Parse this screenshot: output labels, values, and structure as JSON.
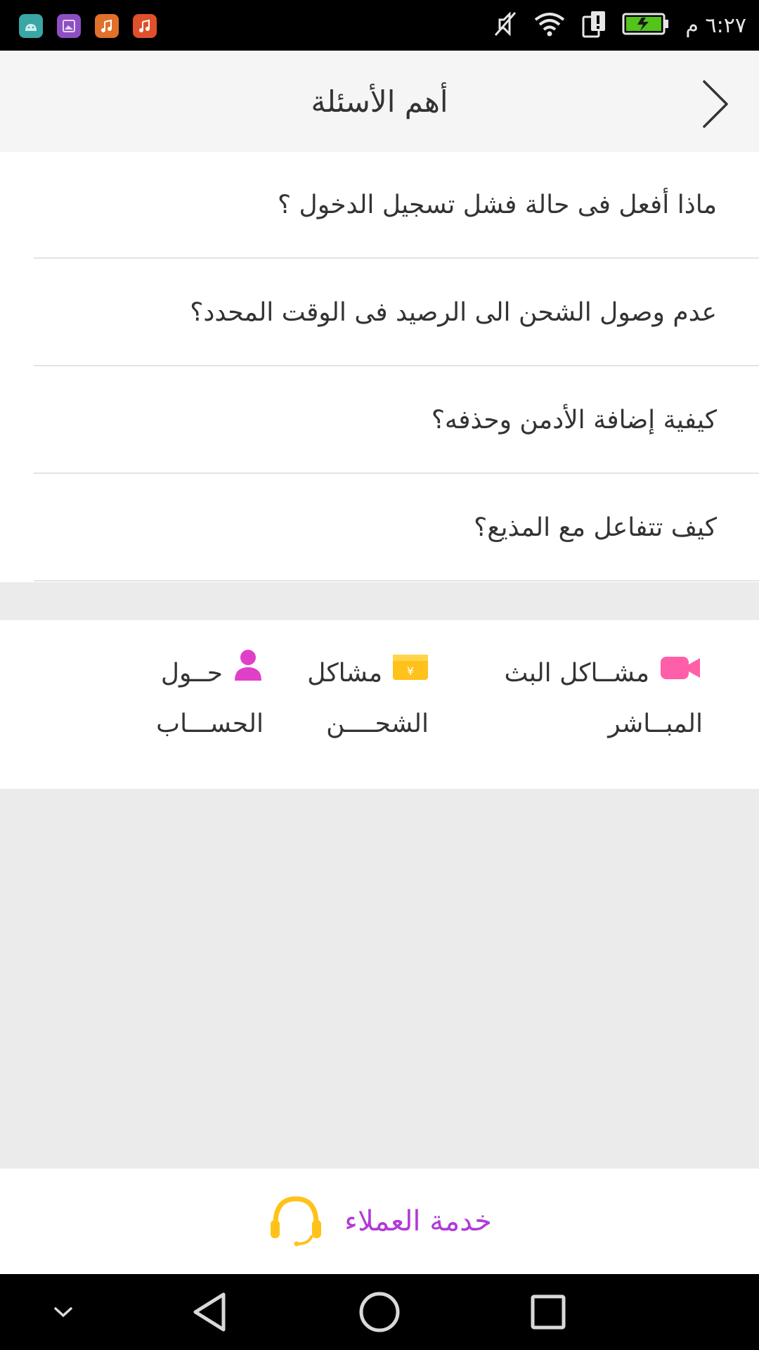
{
  "status_bar": {
    "time": "٦:٢٧ م",
    "notification_icons": [
      "android-icon",
      "gallery-icon",
      "music-icon",
      "music-icon"
    ],
    "system_icons": [
      "mute-icon",
      "wifi-icon",
      "sim-icon",
      "battery-charging-icon"
    ]
  },
  "header": {
    "title": "أهم الأسئلة",
    "back_icon": "chevron-right-icon"
  },
  "faq": {
    "items": [
      {
        "label": "ماذا أفعل فى حالة فشل تسجيل الدخول ؟"
      },
      {
        "label": "عدم وصول الشحن الى الرصيد فى الوقت المحدد؟"
      },
      {
        "label": "كيفية إضافة الأدمن وحذفه؟"
      },
      {
        "label": "كيف تتفاعل مع المذيع؟"
      }
    ]
  },
  "categories": [
    {
      "line1": "مشــاكل البث",
      "line2": "المبــاشر",
      "icon": "video-camera-icon",
      "color": "#ff5fa8"
    },
    {
      "line1": "مشاكل",
      "line2": "الشحــــن",
      "icon": "wallet-yen-icon",
      "color": "#ffc21a"
    },
    {
      "line1": "حــول",
      "line2": "الحســـاب",
      "icon": "user-icon",
      "color": "#e040c8"
    }
  ],
  "footer": {
    "label": "خدمة العملاء",
    "icon": "headset-icon",
    "color": "#b13bd6",
    "icon_color": "#ffc21a"
  },
  "nav_bar": {
    "buttons": [
      "chevron-down-icon",
      "back-triangle-icon",
      "home-circle-icon",
      "recents-square-icon"
    ]
  }
}
